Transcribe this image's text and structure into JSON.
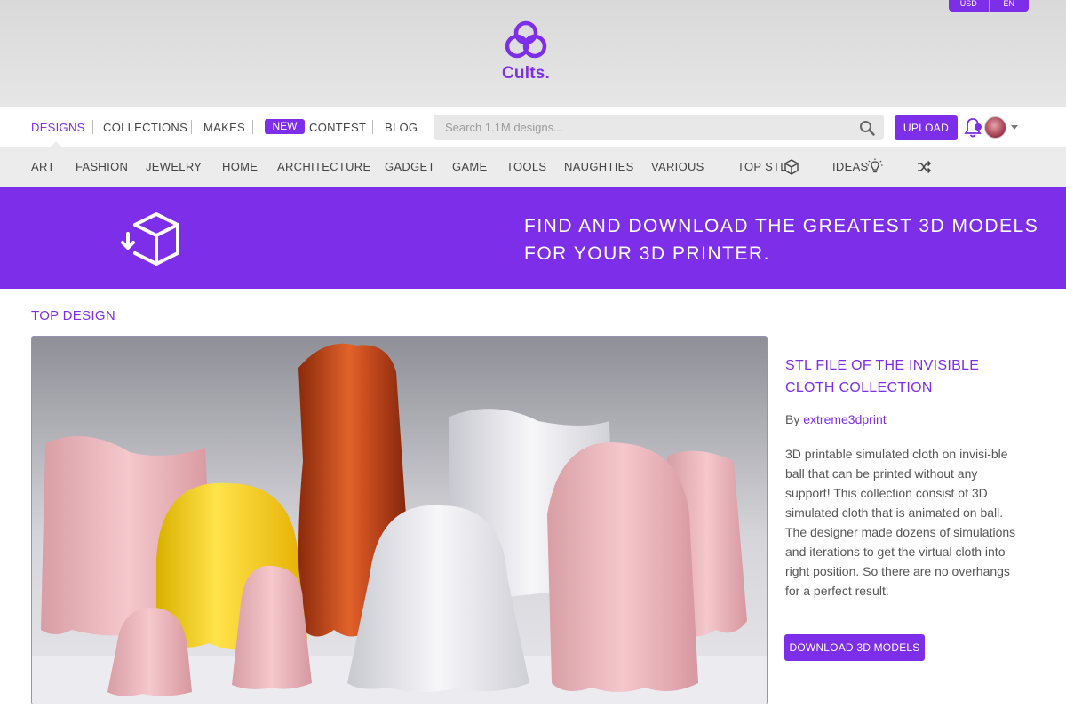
{
  "topbar": {
    "currency": "USD",
    "language": "EN"
  },
  "logo": {
    "text": "Cults."
  },
  "nav": {
    "items": [
      "DESIGNS",
      "COLLECTIONS",
      "MAKES",
      "CONTEST",
      "BLOG"
    ],
    "new_badge": "NEW",
    "search_placeholder": "Search 1.1M designs...",
    "upload_label": "UPLOAD"
  },
  "categories": {
    "items": [
      "ART",
      "FASHION",
      "JEWELRY",
      "HOME",
      "ARCHITECTURE",
      "GADGET",
      "GAME",
      "TOOLS",
      "NAUGHTIES",
      "VARIOUS"
    ],
    "top_stl": "TOP STL",
    "ideas": "IDEAS"
  },
  "banner": {
    "line1": "FIND AND DOWNLOAD THE GREATEST 3D MODELS",
    "line2": "FOR YOUR 3D PRINTER."
  },
  "content": {
    "section_title": "TOP DESIGN",
    "design_title": "STL FILE OF THE INVISIBLE CLOTH COLLECTION",
    "by_label": "By",
    "author": "extreme3dprint",
    "description": "3D printable simulated cloth on invisi-ble ball that can be printed without any support! This collection consist of 3D simulated cloth that is animated on ball. The designer made dozens of simulations and iterations to get the virtual cloth into right position. So there are no overhangs for a perfect result.",
    "download_label": "DOWNLOAD 3D MODELS"
  },
  "colors": {
    "accent": "#7c2ee8",
    "nav_bg": "#ececec",
    "header_bg": "#dedede"
  }
}
